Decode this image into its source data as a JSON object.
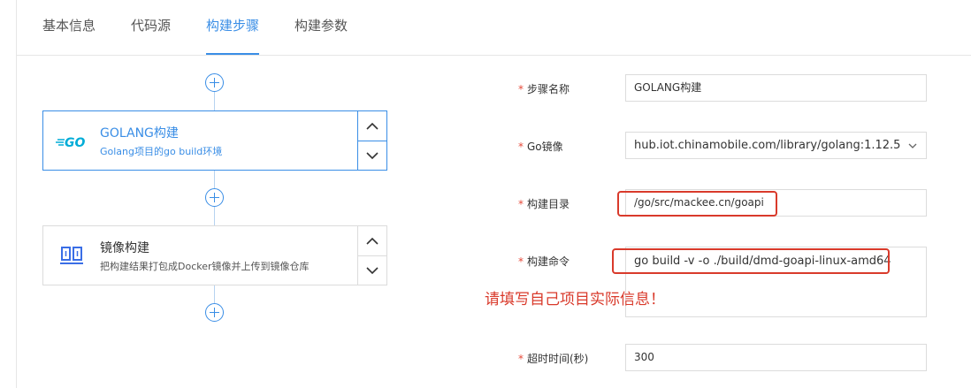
{
  "tabs": [
    {
      "label": "基本信息",
      "active": false
    },
    {
      "label": "代码源",
      "active": false
    },
    {
      "label": "构建步骤",
      "active": true
    },
    {
      "label": "构建参数",
      "active": false
    }
  ],
  "steps": [
    {
      "title": "GOLANG构建",
      "desc": "Golang项目的go build环境",
      "icon": "golang-logo-icon",
      "icon_text": "GO",
      "selected": true
    },
    {
      "title": "镜像构建",
      "desc": "把构建结果打包成Docker镜像并上传到镜像仓库",
      "icon": "docker-image-icon",
      "selected": false
    }
  ],
  "form": {
    "required_mark": "*",
    "step_name": {
      "label": "步骤名称",
      "value": "GOLANG构建"
    },
    "go_image": {
      "label": "Go镜像",
      "value": "hub.iot.chinamobile.com/library/golang:1.12.5"
    },
    "build_dir": {
      "label": "构建目录",
      "value": "/go/src/mackee.cn/goapi"
    },
    "build_cmd": {
      "label": "构建命令",
      "value": "go build -v -o ./build/dmd-goapi-linux-amd64"
    },
    "timeout": {
      "label": "超时时间(秒)",
      "value": "300"
    }
  },
  "annotation": {
    "text": "请填写自己项目实际信息！",
    "color": "#d93a2b"
  },
  "colors": {
    "accent": "#3a8ee6",
    "required": "#e64a3a",
    "highlight": "#d93a2b",
    "golang": "#00acd7"
  }
}
